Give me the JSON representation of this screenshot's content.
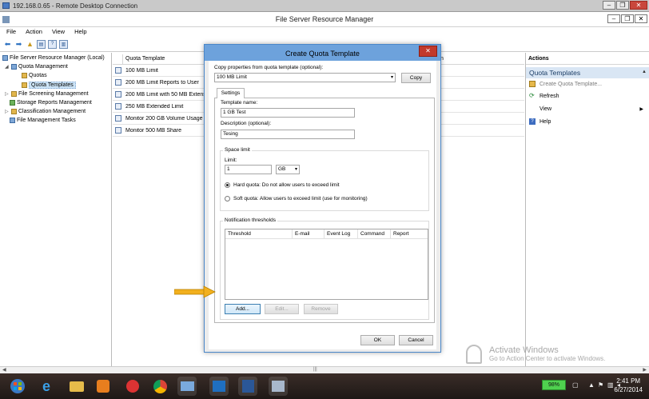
{
  "rdp": {
    "title": "192.168.0.65 - Remote Desktop Connection"
  },
  "window": {
    "title": "File Server Resource Manager"
  },
  "menu": [
    "File",
    "Action",
    "View",
    "Help"
  ],
  "tree": {
    "items": [
      {
        "label": "File Server Resource Manager (Local)"
      },
      {
        "label": "Quota Management"
      },
      {
        "label": "Quotas"
      },
      {
        "label": "Quota Templates"
      },
      {
        "label": "File Screening Management"
      },
      {
        "label": "Storage Reports Management"
      },
      {
        "label": "Classification Management"
      },
      {
        "label": "File Management Tasks"
      }
    ]
  },
  "list": {
    "column": "Quota Template",
    "column2_partial": "n",
    "rows": [
      "100 MB Limit",
      "200 MB Limit Reports to User",
      "200 MB Limit with 50 MB Extens",
      "250 MB Extended Limit",
      "Monitor 200 GB Volume Usage",
      "Monitor 500 MB Share"
    ]
  },
  "actions": {
    "header": "Actions",
    "section": "Quota Templates",
    "items": [
      {
        "label": "Create Quota Template...",
        "disabled": true
      },
      {
        "label": "Refresh"
      },
      {
        "label": "View"
      },
      {
        "label": "Help"
      }
    ]
  },
  "dialog": {
    "title": "Create Quota Template",
    "copy_label": "Copy properties from quota template (optional):",
    "copy_value": "100 MB Limit",
    "copy_button": "Copy",
    "tab": "Settings",
    "template_name_label": "Template name:",
    "template_name_value": "1 GB Test",
    "description_label": "Description (optional):",
    "description_value": "Tesing",
    "space_limit_title": "Space limit",
    "limit_label": "Limit:",
    "limit_value": "1",
    "limit_unit": "GB",
    "hard_quota": "Hard quota: Do not allow users to exceed limit",
    "soft_quota": "Soft quota: Allow users to exceed limit (use for monitoring)",
    "notification_title": "Notification thresholds",
    "grid_columns": [
      "Threshold",
      "E-mail",
      "Event Log",
      "Command",
      "Report"
    ],
    "add_button": "Add...",
    "edit_button": "Edit...",
    "remove_button": "Remove",
    "ok_button": "OK",
    "cancel_button": "Cancel"
  },
  "watermark": {
    "line1": "Activate Windows",
    "line2": "Go to Action Center to activate Windows."
  },
  "taskbar": {
    "battery": "98%",
    "time": "2:41 PM",
    "date": "6/27/2014"
  },
  "colors": {
    "dialog_title": "#6da2dc",
    "close_button": "#c2392b",
    "selection": "#cce4f7",
    "arrow": "#f2b01e"
  }
}
